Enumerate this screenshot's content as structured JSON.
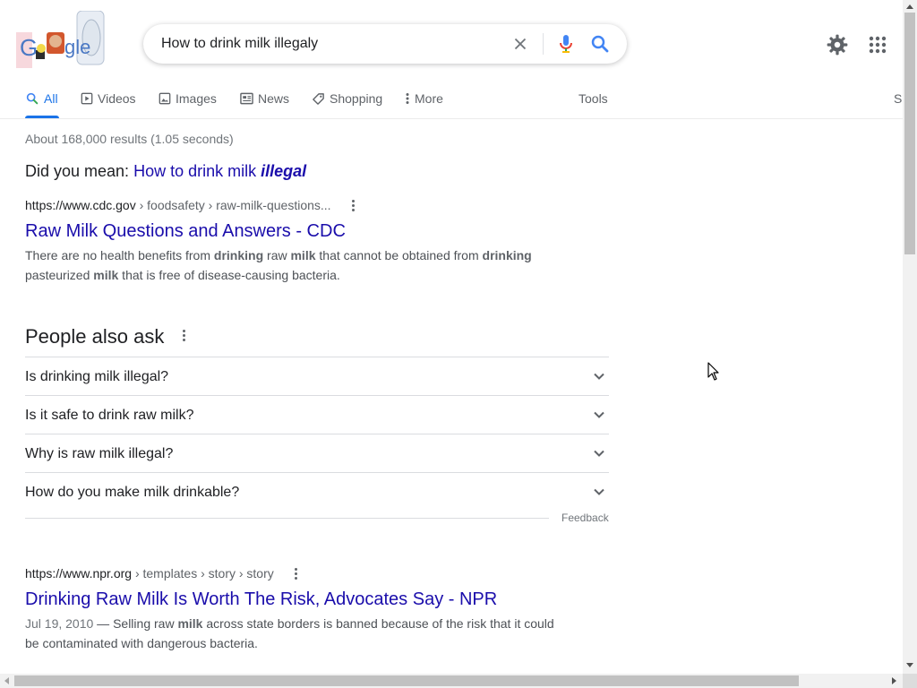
{
  "search": {
    "query": "How to drink milk illegaly",
    "logo_text": "Google"
  },
  "tabs": [
    {
      "label": "All",
      "active": true
    },
    {
      "label": "Videos"
    },
    {
      "label": "Images"
    },
    {
      "label": "News"
    },
    {
      "label": "Shopping"
    },
    {
      "label": "More"
    }
  ],
  "tools_label": "Tools",
  "cut_off_label": "S",
  "result_stats": "About 168,000 results (1.05 seconds)",
  "did_you_mean": {
    "prefix": "Did you mean:",
    "suggestion_plain": "How to drink milk",
    "suggestion_corrected": "illegal"
  },
  "results": [
    {
      "domain": "https://www.cdc.gov",
      "path": " › foodsafety › raw-milk-questions...",
      "title": "Raw Milk Questions and Answers - CDC",
      "snippet_parts": [
        "There are no health benefits from ",
        "drinking",
        " raw ",
        "milk",
        " that cannot be obtained from ",
        "drinking",
        " pasteurized ",
        "milk",
        " that is free of disease-causing bacteria."
      ]
    },
    {
      "domain": "https://www.npr.org",
      "path": " › templates › story › story",
      "title": "Drinking Raw Milk Is Worth The Risk, Advocates Say - NPR",
      "date": "Jul 19, 2010",
      "snippet_parts": [
        " — Selling raw ",
        "milk",
        " across state borders is banned because of the risk that it could be contaminated with dangerous bacteria."
      ]
    }
  ],
  "people_also_ask": {
    "heading": "People also ask",
    "questions": [
      "Is drinking milk illegal?",
      "Is it safe to drink raw milk?",
      "Why is raw milk illegal?",
      "How do you make milk drinkable?"
    ],
    "feedback_label": "Feedback"
  },
  "colors": {
    "link": "#1a0dab",
    "accent": "#1a73e8",
    "text": "#202124",
    "secondary": "#5f6368"
  },
  "icons": [
    "clear-icon",
    "mic-icon",
    "search-icon",
    "gear-icon",
    "apps-grid-icon",
    "chevron-down-icon",
    "more-vert-icon"
  ]
}
